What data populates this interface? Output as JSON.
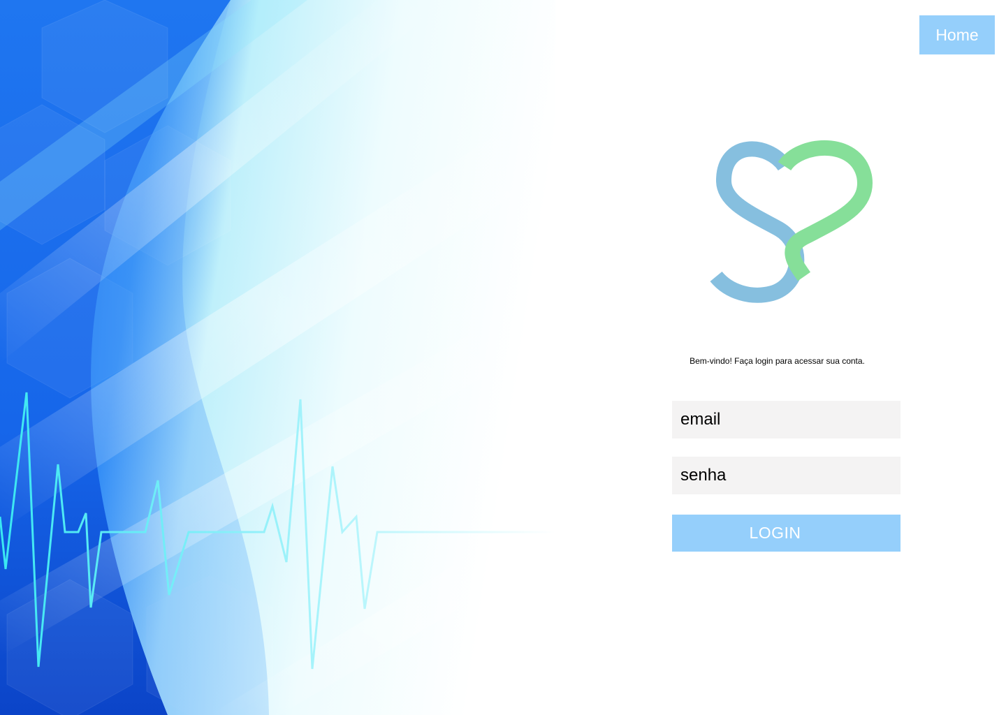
{
  "header": {
    "home_label": "Home"
  },
  "login": {
    "welcome_text": "Bem-vindo! Faça login para acessar sua conta.",
    "email_placeholder": "email",
    "password_placeholder": "senha",
    "login_label": "LOGIN"
  },
  "brand": {
    "logo_icon": "heart-s-logo-icon",
    "logo_colors": [
      "#86bfdf",
      "#86df99"
    ]
  },
  "colors": {
    "accent": "#95cffb",
    "field_background": "#f4f3f3",
    "hero_blue": "#0a6cf2"
  },
  "hero": {
    "illustration": "heartbeat-background-image"
  }
}
